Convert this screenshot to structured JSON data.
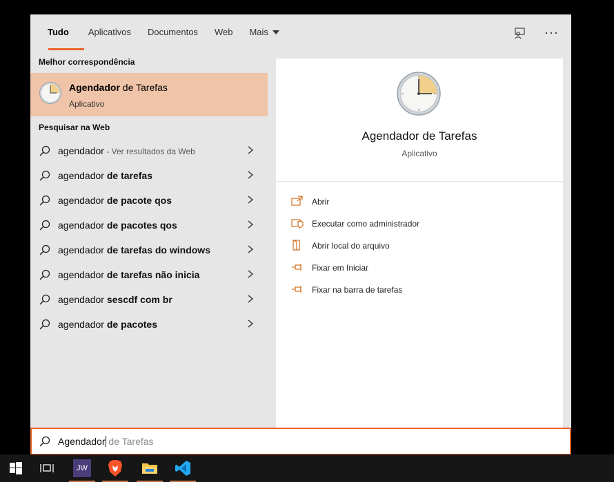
{
  "tabs": [
    {
      "label": "Tudo",
      "active": true
    },
    {
      "label": "Aplicativos"
    },
    {
      "label": "Documentos"
    },
    {
      "label": "Web"
    },
    {
      "label": "Mais"
    }
  ],
  "top_icons": [
    "feedback-icon",
    "more-options-icon"
  ],
  "best_match": {
    "section_label": "Melhor correspondência",
    "title_bold": "Agendador",
    "title_rest": " de Tarefas",
    "subtitle": "Aplicativo",
    "icon": "clock-icon"
  },
  "web": {
    "section_label": "Pesquisar na Web",
    "items": [
      {
        "prefix": "agendador",
        "bold": "",
        "hint": " - Ver resultados da Web"
      },
      {
        "prefix": "agendador ",
        "bold": "de tarefas",
        "hint": ""
      },
      {
        "prefix": "agendador ",
        "bold": "de pacote qos",
        "hint": ""
      },
      {
        "prefix": "agendador ",
        "bold": "de pacotes qos",
        "hint": ""
      },
      {
        "prefix": "agendador ",
        "bold": "de tarefas do windows",
        "hint": ""
      },
      {
        "prefix": "agendador ",
        "bold": "de tarefas não inicia",
        "hint": ""
      },
      {
        "prefix": "agendador ",
        "bold": "sescdf com br",
        "hint": ""
      },
      {
        "prefix": "agendador ",
        "bold": "de pacotes",
        "hint": ""
      }
    ]
  },
  "details": {
    "title": "Agendador de Tarefas",
    "subtitle": "Aplicativo",
    "actions": [
      {
        "label": "Abrir",
        "icon": "open-icon"
      },
      {
        "label": "Executar como administrador",
        "icon": "shield-icon"
      },
      {
        "label": "Abrir local do arquivo",
        "icon": "file-location-icon"
      },
      {
        "label": "Fixar em Iniciar",
        "icon": "pin-icon"
      },
      {
        "label": "Fixar na barra de tarefas",
        "icon": "pin-icon"
      }
    ]
  },
  "search": {
    "typed": "Agendador",
    "suggestion": " de Tarefas"
  },
  "taskbar": {
    "items": [
      "windows-start-icon",
      "task-view-icon",
      "jw-app-icon",
      "brave-browser-icon",
      "file-explorer-icon",
      "vscode-icon"
    ],
    "jw_label": "JW"
  },
  "colors": {
    "accent": "#e8652a",
    "best_match_bg": "#f0c4a8",
    "panel_bg": "#e6e6e6",
    "taskbar_bg": "#161616"
  }
}
